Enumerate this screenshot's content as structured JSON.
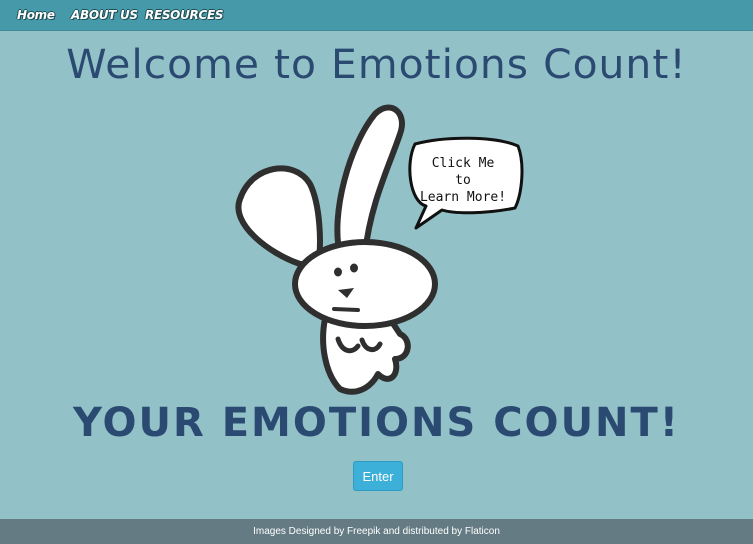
{
  "nav": {
    "home": "Home",
    "about": "ABOUT US",
    "resources": "RESOURCES"
  },
  "main": {
    "title": "Welcome to Emotions Count!",
    "bubble_text": "Click Me\nto\nLearn More!",
    "tagline": "YOUR EMOTIONS COUNT!",
    "enter_label": "Enter"
  },
  "footer": {
    "text": "Images Designed by Freepik and distributed by Flaticon"
  },
  "colors": {
    "background": "#92c1c8",
    "navbar": "#4699a8",
    "heading": "#2b4a72",
    "button": "#3cb0d8",
    "footer": "#647b83"
  }
}
